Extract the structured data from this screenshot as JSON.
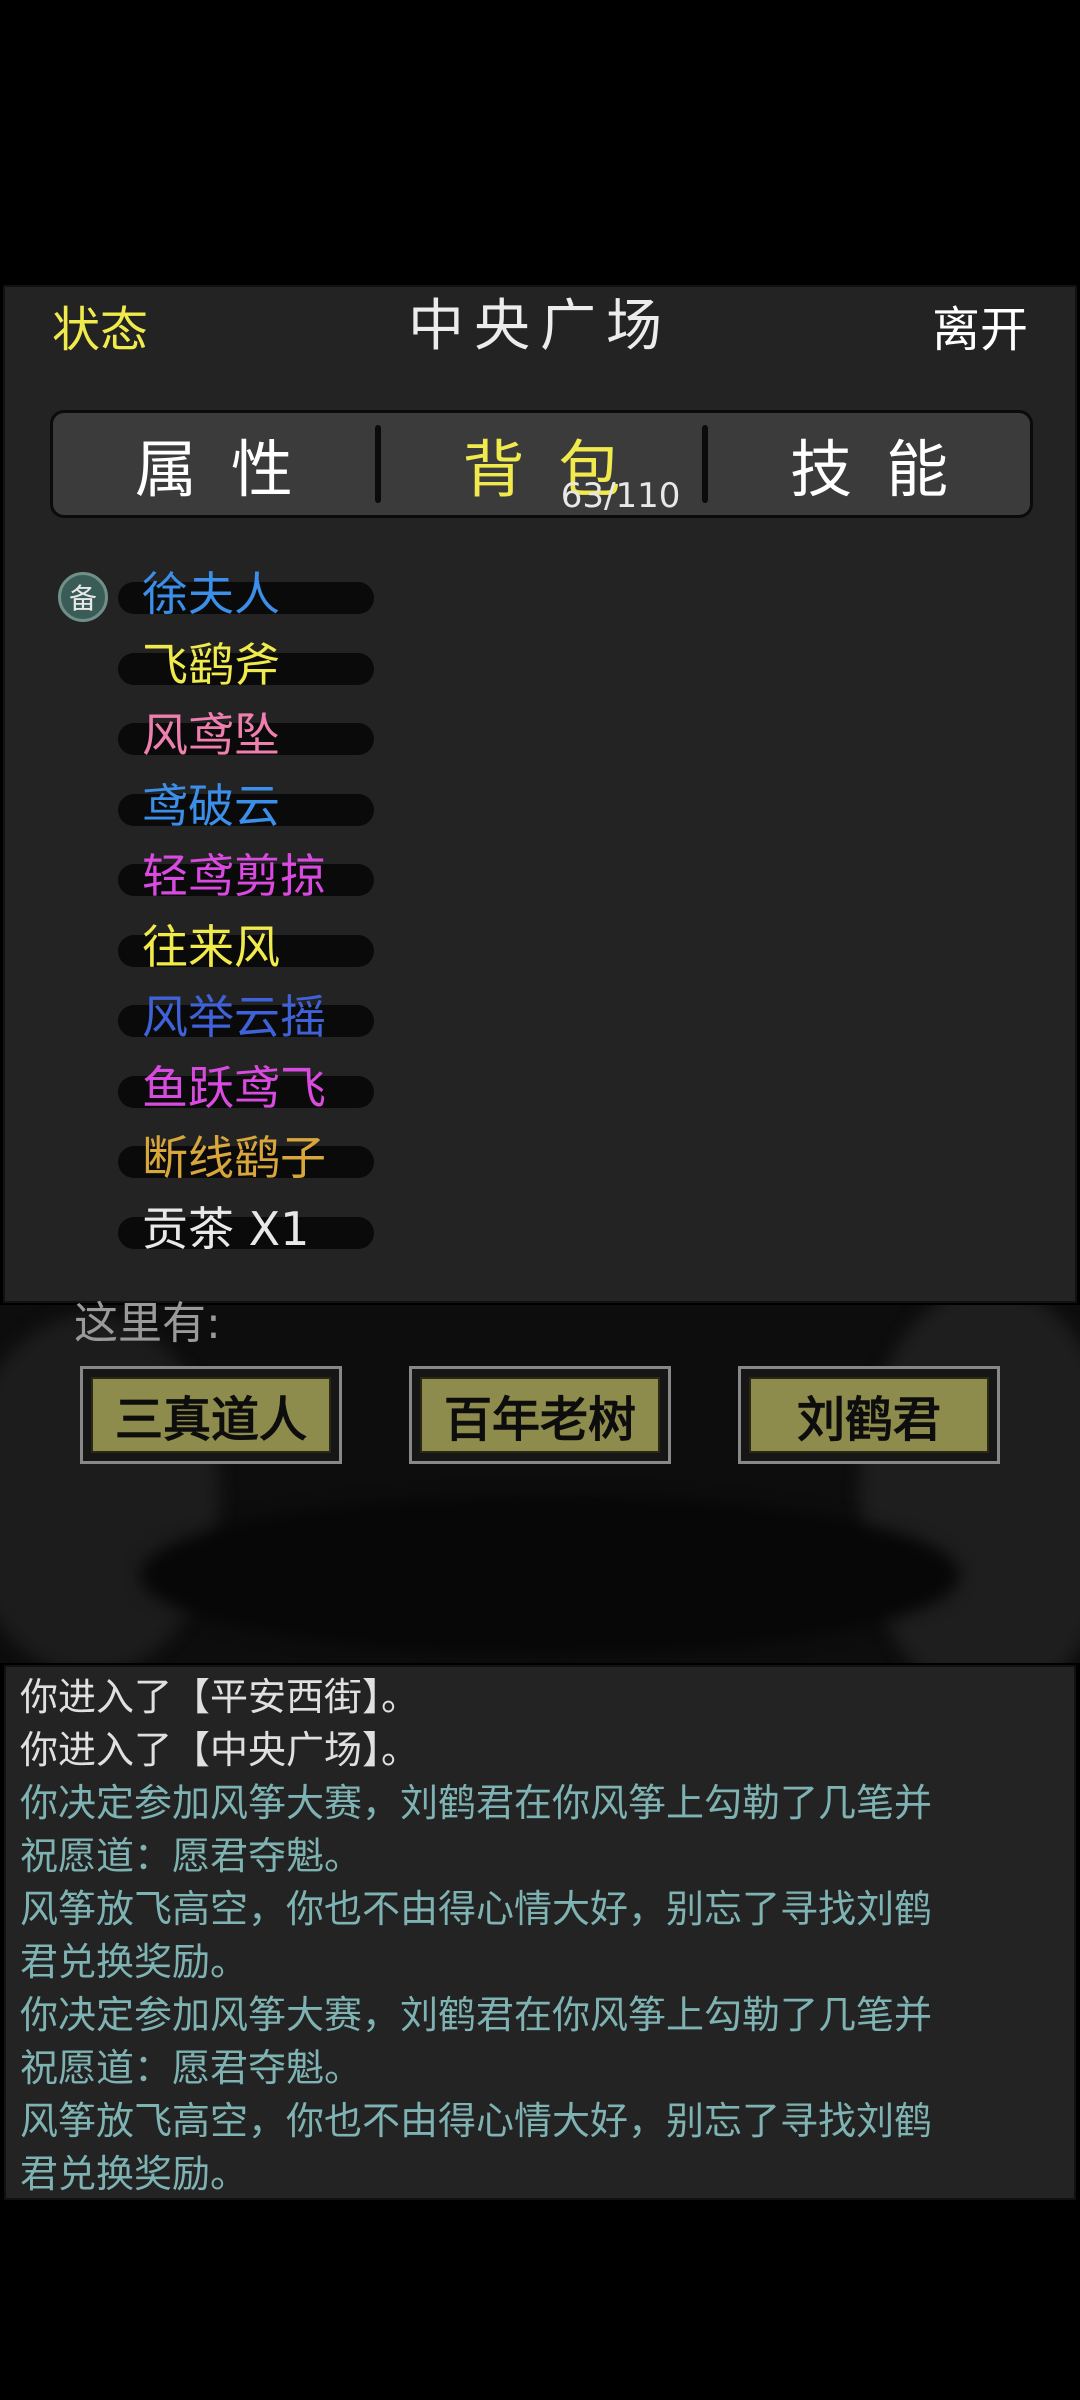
{
  "header": {
    "status_label": "状态",
    "location_title": "中央广场",
    "leave_label": "离开"
  },
  "tabs": [
    {
      "label": "属性",
      "active": false
    },
    {
      "label": "背包",
      "active": true,
      "count": "63/110"
    },
    {
      "label": "技能",
      "active": false
    }
  ],
  "inventory": {
    "equipped_badge": "备",
    "items": [
      {
        "name": "徐夫人",
        "color": "#3b8fe8"
      },
      {
        "name": "飞鹞斧",
        "color": "#f0ea4c"
      },
      {
        "name": "风鸢坠",
        "color": "#ee7fae"
      },
      {
        "name": "鸢破云",
        "color": "#3b8fe8"
      },
      {
        "name": "轻鸢剪掠",
        "color": "#d94be0"
      },
      {
        "name": "往来风",
        "color": "#f0ea4c"
      },
      {
        "name": "风举云摇",
        "color": "#3f62d8"
      },
      {
        "name": "鱼跃鸢飞",
        "color": "#d94be0"
      },
      {
        "name": "断线鹞子",
        "color": "#d9a63c"
      },
      {
        "name": "贡茶 X1",
        "color": "#e8e8e8"
      }
    ]
  },
  "scene": {
    "here_label": "这里有:",
    "npcs": [
      "三真道人",
      "百年老树",
      "刘鹤君"
    ]
  },
  "log": {
    "lines": [
      {
        "text": "你进入了【平安西街】。",
        "color": "#e0e0e0"
      },
      {
        "text": "你进入了【中央广场】。",
        "color": "#e0e0e0"
      },
      {
        "text": "你决定参加风筝大赛，刘鹤君在你风筝上勾勒了几笔并",
        "color": "#7fb3b3"
      },
      {
        "text": "祝愿道：愿君夺魁。",
        "color": "#7fb3b3"
      },
      {
        "text": "风筝放飞高空，你也不由得心情大好，别忘了寻找刘鹤",
        "color": "#7fb3b3"
      },
      {
        "text": "君兑换奖励。",
        "color": "#7fb3b3"
      },
      {
        "text": "你决定参加风筝大赛，刘鹤君在你风筝上勾勒了几笔并",
        "color": "#7fb3b3"
      },
      {
        "text": "祝愿道：愿君夺魁。",
        "color": "#7fb3b3"
      },
      {
        "text": "风筝放飞高空，你也不由得心情大好，别忘了寻找刘鹤",
        "color": "#7fb3b3"
      },
      {
        "text": "君兑换奖励。",
        "color": "#7fb3b3"
      }
    ]
  },
  "colors": {
    "accent_yellow": "#f0ea4c",
    "panel_bg": "#232323",
    "npc_button": "#8e8c4c"
  }
}
